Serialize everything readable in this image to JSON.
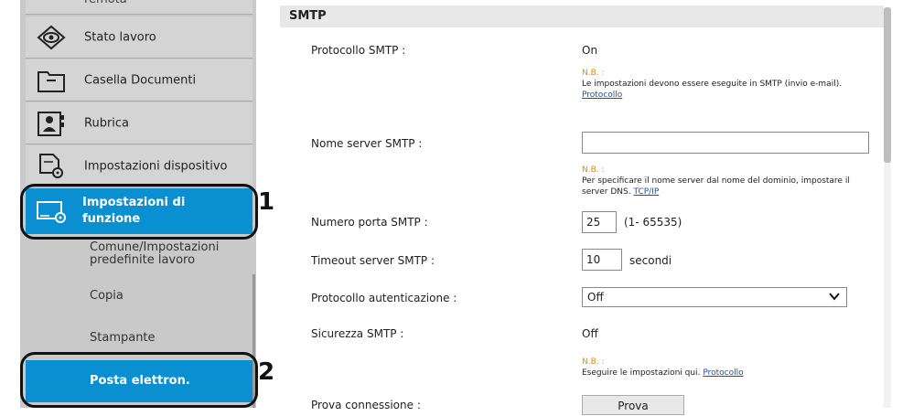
{
  "sidebar": {
    "top_partial_label": "remota",
    "items": [
      {
        "label": "Stato lavoro",
        "icon": "eye-icon"
      },
      {
        "label": "Casella Documenti",
        "icon": "folder-icon"
      },
      {
        "label": "Rubrica",
        "icon": "address-book-icon"
      },
      {
        "label": "Impostazioni dispositivo",
        "icon": "device-settings-icon"
      },
      {
        "label": "Impostazioni di funzione",
        "icon": "function-settings-icon"
      }
    ],
    "sub_items": [
      {
        "label": "Comune/Impostazioni predefinite lavoro"
      },
      {
        "label": "Copia"
      },
      {
        "label": "Stampante"
      },
      {
        "label": "Posta elettron."
      }
    ]
  },
  "callouts": {
    "one": "1",
    "two": "2"
  },
  "section": {
    "title": "SMTP"
  },
  "rows": {
    "protocol": {
      "label": "Protocollo SMTP :",
      "value": "On"
    },
    "note1": {
      "nb": "N.B. :",
      "text": "Le impostazioni devono essere eseguite in SMTP (invio e-mail).",
      "link": "Protocollo"
    },
    "server_name": {
      "label": "Nome server SMTP :",
      "value": ""
    },
    "note2": {
      "nb": "N.B. :",
      "text": "Per specificare il nome server dal nome del dominio, impostare il server DNS.",
      "link": "TCP/IP"
    },
    "port": {
      "label": "Numero porta SMTP :",
      "value": "25",
      "range": "(1- 65535)"
    },
    "timeout": {
      "label": "Timeout server SMTP :",
      "value": "10",
      "unit": "secondi"
    },
    "auth": {
      "label": "Protocollo autenticazione :",
      "value": "Off"
    },
    "security": {
      "label": "Sicurezza SMTP :",
      "value": "Off"
    },
    "note3": {
      "nb": "N.B. :",
      "text": "Eseguire le impostazioni qui.",
      "link": "Protocollo"
    },
    "test": {
      "label": "Prova connessione :",
      "button": "Prova"
    }
  }
}
